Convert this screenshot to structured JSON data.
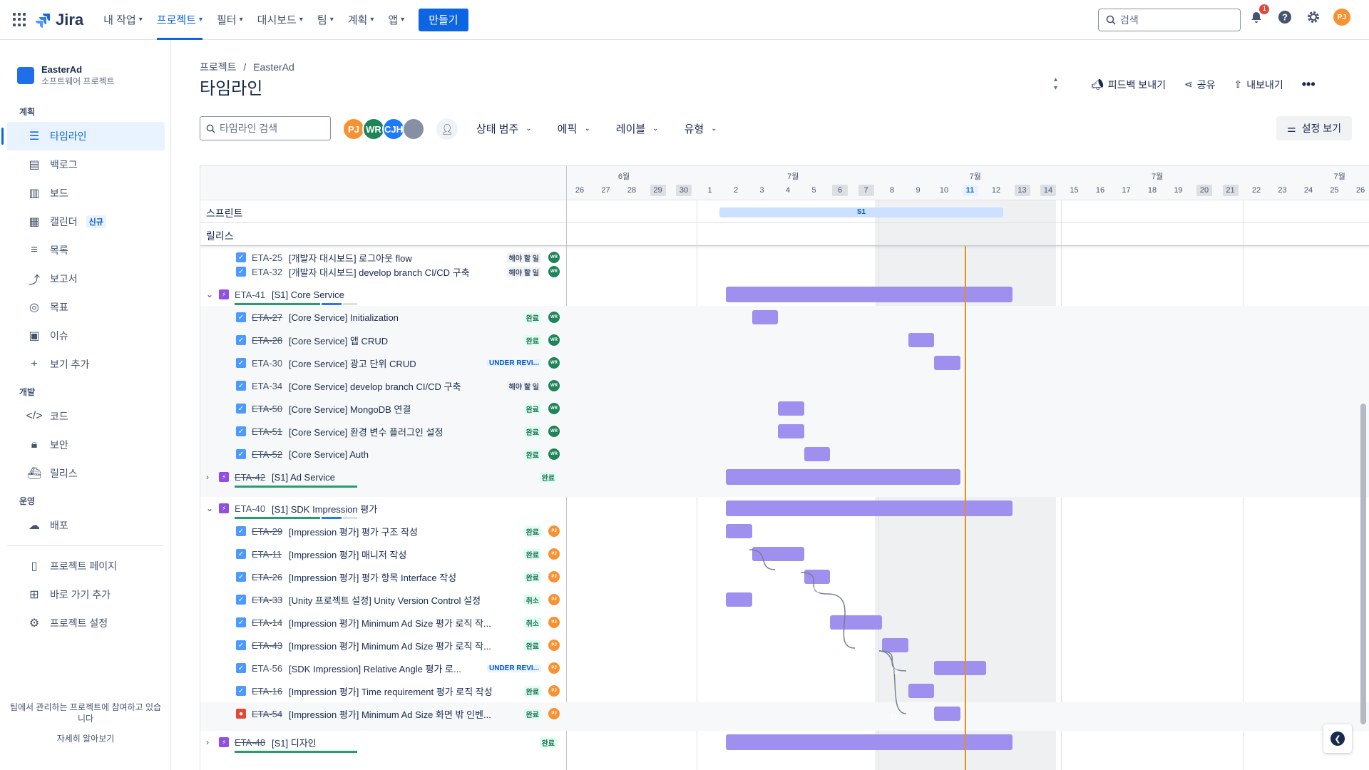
{
  "topnav": {
    "brand": "Jira",
    "items": [
      {
        "label": "내 작업"
      },
      {
        "label": "프로젝트"
      },
      {
        "label": "필터"
      },
      {
        "label": "대시보드"
      },
      {
        "label": "팀"
      },
      {
        "label": "계획"
      },
      {
        "label": "앱"
      }
    ],
    "create": "만들기",
    "search_placeholder": "검색",
    "notif_count": "1",
    "user_initials": "PJ"
  },
  "sidebar": {
    "project_name": "EasterAd",
    "project_type": "소프트웨어 프로젝트",
    "sections": {
      "plan": "계획",
      "dev": "개발",
      "ops": "운영"
    },
    "items": [
      {
        "label": "타임라인"
      },
      {
        "label": "백로그"
      },
      {
        "label": "보드"
      },
      {
        "label": "캘린더",
        "badge": "신규"
      },
      {
        "label": "목록"
      },
      {
        "label": "보고서"
      },
      {
        "label": "목표"
      },
      {
        "label": "이슈"
      },
      {
        "label": "보기 추가"
      },
      {
        "label": "코드"
      },
      {
        "label": "보안"
      },
      {
        "label": "릴리스"
      },
      {
        "label": "배포"
      },
      {
        "label": "프로젝트 페이지"
      },
      {
        "label": "바로 가기 추가"
      },
      {
        "label": "프로젝트 설정"
      }
    ],
    "footer_text": "팀에서 관리하는 프로젝트에 참여하고 있습니다",
    "footer_link": "자세히 알아보기"
  },
  "header": {
    "breadcrumb_root": "프로젝트",
    "breadcrumb_sep": "/",
    "breadcrumb_project": "EasterAd",
    "title": "타임라인",
    "feedback": "피드백 보내기",
    "share": "공유",
    "export": "내보내기"
  },
  "toolbar": {
    "search_placeholder": "타임라인 검색",
    "avatars": [
      {
        "initials": "PJ",
        "color": "#f79232"
      },
      {
        "initials": "WR",
        "color": "#1f845a"
      },
      {
        "initials": "CJH",
        "color": "#1d7afc"
      },
      {
        "initials": "",
        "color": "#8590a2"
      }
    ],
    "filters": [
      {
        "label": "상태 범주"
      },
      {
        "label": "에픽"
      },
      {
        "label": "레이블"
      },
      {
        "label": "유형"
      }
    ],
    "settings": "설정 보기"
  },
  "timeline": {
    "months": [
      "6월",
      "7월",
      "7월",
      "7월",
      "7월"
    ],
    "days": [
      "26",
      "27",
      "28",
      "29",
      "30",
      "1",
      "2",
      "3",
      "4",
      "5",
      "6",
      "7",
      "8",
      "9",
      "10",
      "11",
      "12",
      "13",
      "14",
      "15",
      "16",
      "17",
      "18",
      "19",
      "20",
      "21",
      "22",
      "23",
      "24",
      "25",
      "26"
    ],
    "sprint_row": "스프린트",
    "release_row": "릴리스",
    "sprint_name": "S1"
  },
  "rows": [
    {
      "type": "item",
      "key": "ETA-25",
      "summary": "[개발자 대시보드] 로그아웃 flow",
      "status": "해야 할 일",
      "st": "todo",
      "user": "WR",
      "done": false,
      "partial": true
    },
    {
      "type": "item",
      "key": "ETA-32",
      "summary": "[개발자 대시보드] develop branch CI/CD 구축",
      "status": "해야 할 일",
      "st": "todo",
      "user": "WR",
      "done": false
    },
    {
      "type": "epic",
      "key": "ETA-41",
      "summary": "[S1] Core Service",
      "expanded": true,
      "done": false
    },
    {
      "type": "item",
      "key": "ETA-27",
      "summary": "[Core Service] Initialization",
      "status": "완료",
      "st": "done",
      "user": "WR",
      "done": true
    },
    {
      "type": "item",
      "key": "ETA-28",
      "summary": "[Core Service] 앱 CRUD",
      "status": "완료",
      "st": "done",
      "user": "WR",
      "done": true
    },
    {
      "type": "item",
      "key": "ETA-30",
      "summary": "[Core Service] 광고 단위 CRUD",
      "status": "UNDER REVI...",
      "st": "rev",
      "user": "WR",
      "done": false
    },
    {
      "type": "item",
      "key": "ETA-34",
      "summary": "[Core Service] develop branch CI/CD 구축",
      "status": "해야 할 일",
      "st": "todo",
      "user": "WR",
      "done": false
    },
    {
      "type": "item",
      "key": "ETA-50",
      "summary": "[Core Service] MongoDB 연결",
      "status": "완료",
      "st": "done",
      "user": "WR",
      "done": true
    },
    {
      "type": "item",
      "key": "ETA-51",
      "summary": "[Core Service] 환경 변수 플러그인 설정",
      "status": "완료",
      "st": "done",
      "user": "WR",
      "done": true
    },
    {
      "type": "item",
      "key": "ETA-52",
      "summary": "[Core Service] Auth",
      "status": "완료",
      "st": "done",
      "user": "WR",
      "done": true
    },
    {
      "type": "epic",
      "key": "ETA-42",
      "summary": "[S1] Ad Service",
      "expanded": false,
      "done": true,
      "status": "완료"
    },
    {
      "type": "epic",
      "key": "ETA-40",
      "summary": "[S1] SDK Impression 평가",
      "expanded": true,
      "done": false
    },
    {
      "type": "item",
      "key": "ETA-29",
      "summary": "[Impression 평가] 평가 구조 작성",
      "status": "완료",
      "st": "done",
      "user": "PJ",
      "done": true
    },
    {
      "type": "item",
      "key": "ETA-11",
      "summary": "[Impression 평가] 매니저 작성",
      "status": "완료",
      "st": "done",
      "user": "PJ",
      "done": true
    },
    {
      "type": "item",
      "key": "ETA-26",
      "summary": "[Impression 평가] 평가 항목 Interface 작성",
      "status": "완료",
      "st": "done",
      "user": "PJ",
      "done": true
    },
    {
      "type": "item",
      "key": "ETA-33",
      "summary": "[Unity 프로젝트 설정] Unity Version Control 설정",
      "status": "취소",
      "st": "done",
      "user": "PJ",
      "done": true
    },
    {
      "type": "item",
      "key": "ETA-14",
      "summary": "[Impression 평가] Minimum Ad Size 평가 로직 작...",
      "status": "취소",
      "st": "done",
      "user": "PJ",
      "done": true
    },
    {
      "type": "item",
      "key": "ETA-43",
      "summary": "[Impression 평가] Minimum Ad Size 평가 로직 작...",
      "status": "완료",
      "st": "done",
      "user": "PJ",
      "done": true
    },
    {
      "type": "item",
      "key": "ETA-56",
      "summary": "[SDK Impression] Relative Angle 평가 로...",
      "status": "UNDER REVI...",
      "st": "rev",
      "user": "PJ",
      "done": false
    },
    {
      "type": "item",
      "key": "ETA-16",
      "summary": "[Impression 평가] Time requirement 평가 로직 작성",
      "status": "완료",
      "st": "done",
      "user": "PJ",
      "done": true
    },
    {
      "type": "item",
      "key": "ETA-54",
      "summary": "[Impression 평가] Minimum Ad Size 화면 밖 인벤...",
      "status": "완료",
      "st": "done",
      "user": "PJ",
      "done": true,
      "bug": true
    },
    {
      "type": "epic",
      "key": "ETA-48",
      "summary": "[S1] 디자인",
      "expanded": false,
      "done": true,
      "status": "완료"
    }
  ],
  "colors": {
    "bar": "#9f8fef",
    "today": "#f18d13",
    "accent": "#0c66e4"
  }
}
